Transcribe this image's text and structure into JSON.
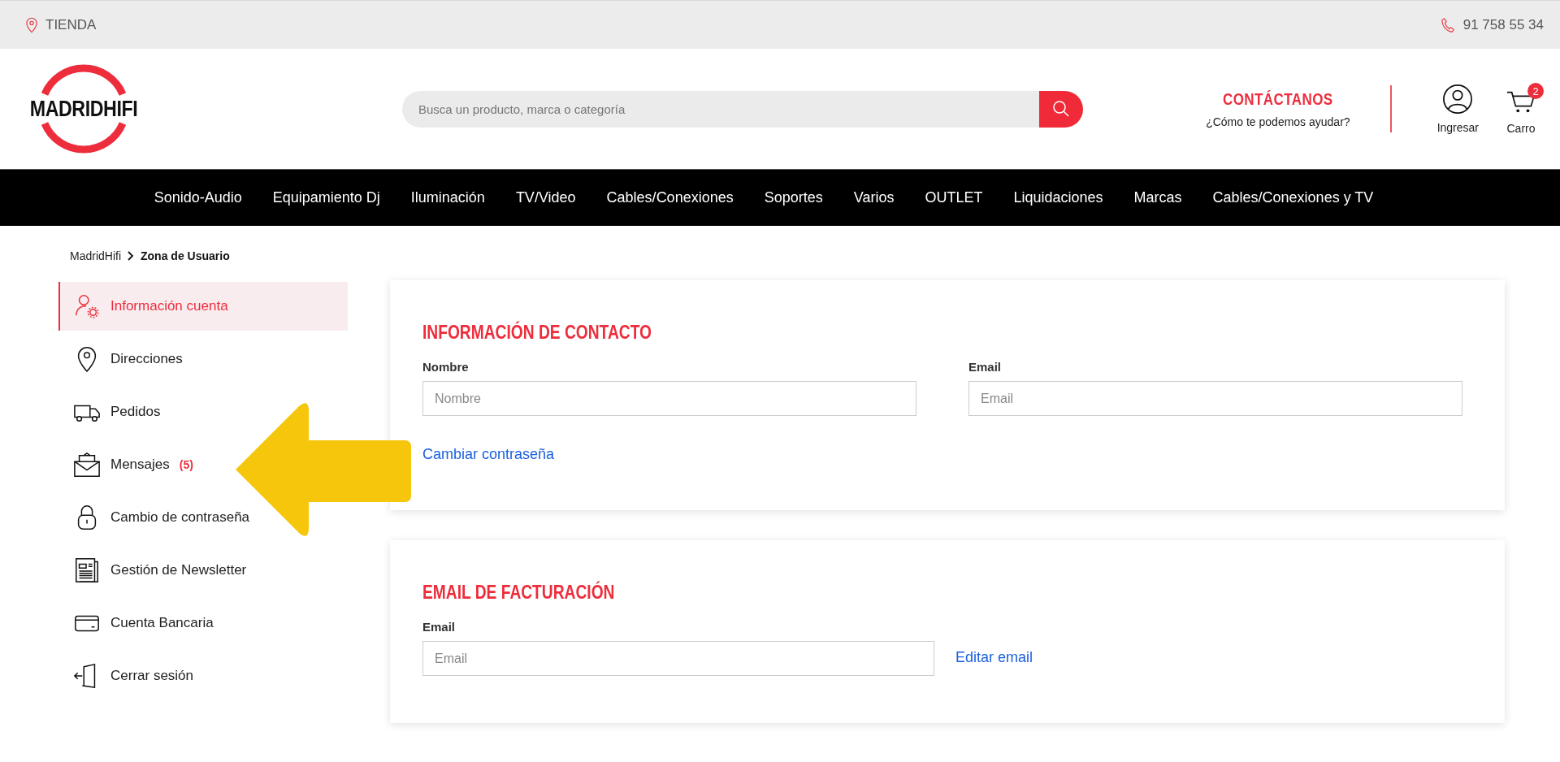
{
  "top_bar": {
    "store": "TIENDA",
    "phone": "91 758 55 34"
  },
  "header": {
    "logo": "MADRIDHIFI",
    "search": {
      "placeholder": "Busca un producto, marca o categoría"
    },
    "contact": {
      "title": "CONTÁCTANOS",
      "subtitle": "¿Cómo te podemos ayudar?"
    },
    "login": "Ingresar",
    "cart": {
      "label": "Carro",
      "count": "2"
    }
  },
  "nav": [
    "Sonido-Audio",
    "Equipamiento Dj",
    "Iluminación",
    "TV/Video",
    "Cables/Conexiones",
    "Soportes",
    "Varios",
    "OUTLET",
    "Liquidaciones",
    "Marcas",
    "Cables/Conexiones y TV"
  ],
  "breadcrumb": [
    {
      "label": "MadridHifi",
      "current": false
    },
    {
      "label": "Zona de Usuario",
      "current": true
    }
  ],
  "sidebar": {
    "items": [
      {
        "kind": "user",
        "label": "Información cuenta",
        "selected": true
      },
      {
        "kind": "pin",
        "label": "Direcciones",
        "selected": false
      },
      {
        "kind": "truck",
        "label": "Pedidos",
        "selected": false
      },
      {
        "kind": "mail",
        "label": "Mensajes",
        "badge": "(5)",
        "selected": false
      },
      {
        "kind": "lock",
        "label": "Cambio de contraseña",
        "selected": false
      },
      {
        "kind": "news",
        "label": "Gestión de Newsletter",
        "selected": false
      },
      {
        "kind": "card",
        "label": "Cuenta Bancaria",
        "selected": false
      },
      {
        "kind": "exit",
        "label": "Cerrar sesión",
        "selected": false
      }
    ]
  },
  "cards": [
    {
      "title": "INFORMACIÓN DE CONTACTO",
      "fields": [
        {
          "label": "Nombre",
          "placeholder": "Nombre"
        },
        {
          "label": "Email",
          "placeholder": "Email"
        }
      ],
      "link": "Cambiar contraseña"
    },
    {
      "title": "EMAIL DE FACTURACIÓN",
      "fields": [
        {
          "label": "Email",
          "placeholder": "Email"
        }
      ],
      "side_link": "Editar email"
    }
  ]
}
